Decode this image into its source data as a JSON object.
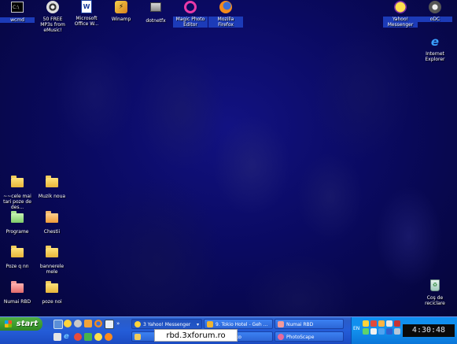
{
  "desktop": {
    "top_icons": [
      {
        "label": "wcmd",
        "icon": "command-prompt-icon"
      },
      {
        "label": "50 FREE MP3s from eMusic!",
        "icon": "emusic-disc-icon"
      },
      {
        "label": "Microsoft Office W...",
        "icon": "word-document-icon"
      },
      {
        "label": "Winamp",
        "icon": "winamp-icon"
      },
      {
        "label": "dotnetfx",
        "icon": "installer-icon"
      },
      {
        "label": "Magic Photo Editor",
        "icon": "magic-photo-editor-icon"
      },
      {
        "label": "Mozilla Firefox",
        "icon": "firefox-icon"
      },
      {
        "label": "Yahoo! Messenger",
        "icon": "yahoo-messenger-icon"
      },
      {
        "label": "oDC",
        "icon": "odc-icon"
      }
    ],
    "right_icons": [
      {
        "label": "Internet Explorer",
        "icon": "internet-explorer-icon"
      },
      {
        "label": "Coş de reciclare",
        "icon": "recycle-bin-icon"
      }
    ],
    "folders": [
      {
        "label": "~~cele mai tari poze de des...",
        "color": "yellow"
      },
      {
        "label": "Muzik noua",
        "color": "yellow"
      },
      {
        "label": "Programe",
        "color": "green"
      },
      {
        "label": "Chestii",
        "color": "orange"
      },
      {
        "label": "Poze q nn",
        "color": "yellow"
      },
      {
        "label": "bannerele mele",
        "color": "yellow"
      },
      {
        "label": "Numai RBD",
        "color": "pink"
      },
      {
        "label": "poze noi",
        "color": "yellow"
      }
    ]
  },
  "taskbar": {
    "start_label": "start",
    "tasks": [
      {
        "label": "3 Yahoo! Messenger",
        "icon": "yahoo-icon"
      },
      {
        "label": "9. Tokio Hotel - Geh ...",
        "icon": "winamp-icon"
      },
      {
        "label": "Numai RBD",
        "icon": "folder-icon"
      },
      {
        "label": "PhotoScape",
        "icon": "photoscape-icon"
      },
      {
        "label": "ko",
        "icon": "folder-icon"
      }
    ],
    "language": "EN",
    "clock": "4:30:48"
  },
  "watermark": "rbd.3xforum.ro",
  "colors": {
    "taskbar": "#245dd8",
    "start": "#3b9b2f",
    "tray": "#1290ed",
    "wallpaper": "#0b0b58"
  }
}
